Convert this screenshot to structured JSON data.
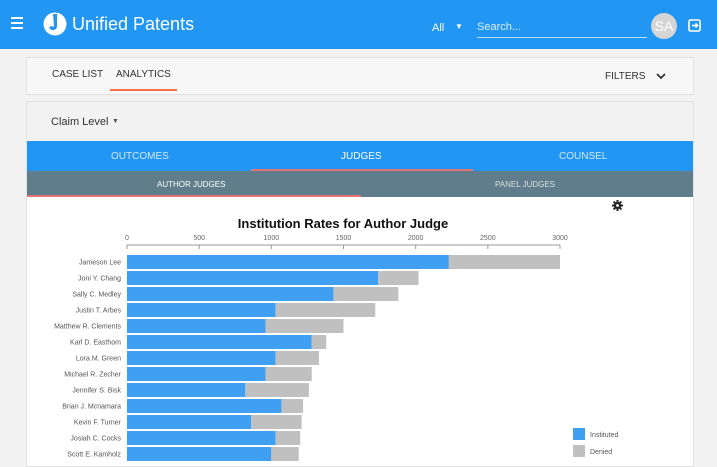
{
  "appbar": {
    "brand": "Unified Patents",
    "scope": "All",
    "search_placeholder": "Search...",
    "avatar_initials": "SA",
    "color": "#2196f3"
  },
  "nav": {
    "case_list": "CASE LIST",
    "analytics": "ANALYTICS",
    "filters": "FILTERS"
  },
  "claim_level": "Claim Level",
  "tabs": [
    "OUTCOMES",
    "JUDGES",
    "COUNSEL"
  ],
  "subtabs": [
    "AUTHOR JUDGES",
    "PANEL JUDGES"
  ],
  "chart_data": {
    "type": "bar",
    "orientation": "horizontal",
    "stacked": true,
    "title": "Institution Rates for Author Judge",
    "xlim": [
      0,
      3000
    ],
    "xticks": [
      0,
      500,
      1000,
      1500,
      2000,
      2500,
      3000
    ],
    "axis_position": "top",
    "legend_position": "bottom-right",
    "categories": [
      "Jameson Lee",
      "Joni Y. Chang",
      "Sally C. Medley",
      "Justin T. Arbes",
      "Matthew R. Clements",
      "Karl D. Easthom",
      "Lora M. Green",
      "Michael R. Zecher",
      "Jennifer S. Bisk",
      "Brian J. Mcnamara",
      "Kevin F. Turner",
      "Josiah C. Cocks",
      "Scott E. Kamholz"
    ],
    "series": [
      {
        "name": "Instituted",
        "color": "#3f9ff2",
        "values": [
          2230,
          1740,
          1430,
          1030,
          960,
          1280,
          1030,
          960,
          820,
          1070,
          860,
          1030,
          1000
        ]
      },
      {
        "name": "Denied",
        "color": "#c0c0c0",
        "values": [
          770,
          280,
          450,
          690,
          540,
          100,
          300,
          320,
          440,
          150,
          350,
          170,
          190
        ]
      }
    ]
  }
}
